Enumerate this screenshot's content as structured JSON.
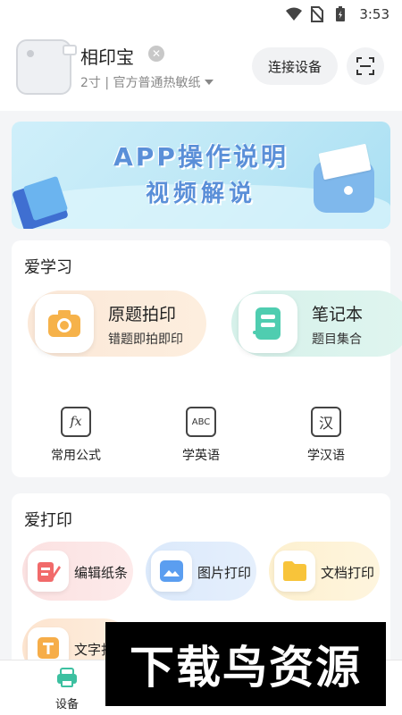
{
  "status_bar": {
    "time": "3:53"
  },
  "device": {
    "name": "相印宝",
    "subtitle": "2寸 | 官方普通热敏纸",
    "connect_label": "连接设备"
  },
  "banner": {
    "line1": "APP操作说明",
    "line2": "视频解说"
  },
  "study": {
    "title": "爱学习",
    "big_tiles": [
      {
        "title": "原题拍印",
        "subtitle": "错题即拍即印",
        "icon": "camera-icon"
      },
      {
        "title": "笔记本",
        "subtitle": "题目集合",
        "icon": "notebook-icon"
      }
    ],
    "small_tiles": [
      {
        "label": "常用公式",
        "glyph": "fx",
        "icon": "formula-icon"
      },
      {
        "label": "学英语",
        "glyph": "ABC",
        "icon": "english-icon"
      },
      {
        "label": "学汉语",
        "glyph": "汉",
        "icon": "chinese-icon"
      }
    ]
  },
  "print": {
    "title": "爱打印",
    "tiles": [
      {
        "label": "编辑纸条",
        "icon": "edit-note-icon"
      },
      {
        "label": "图片打印",
        "icon": "image-icon"
      },
      {
        "label": "文档打印",
        "icon": "folder-icon"
      },
      {
        "label": "文字打",
        "icon": "text-icon"
      }
    ]
  },
  "tabbar": {
    "tabs": [
      {
        "label": "设备",
        "icon": "printer-icon"
      }
    ]
  },
  "watermark": "下载鸟资源",
  "colors": {
    "accent_green": "#3cc0a0",
    "banner_text": "#5a8fd8"
  }
}
